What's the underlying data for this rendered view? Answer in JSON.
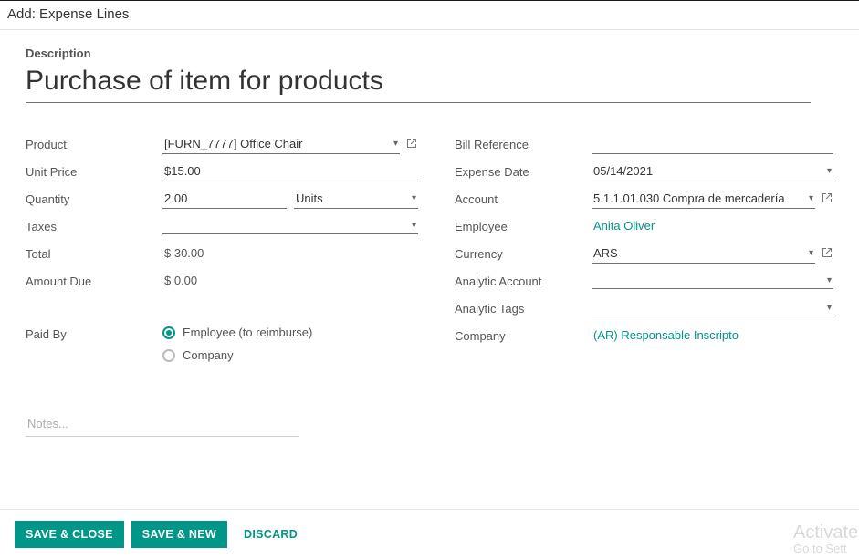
{
  "header": {
    "title": "Add: Expense Lines"
  },
  "description": {
    "label": "Description",
    "value": "Purchase of item for products"
  },
  "left": {
    "product": {
      "label": "Product",
      "value": "[FURN_7777] Office Chair"
    },
    "unit_price": {
      "label": "Unit Price",
      "value": "$15.00"
    },
    "quantity": {
      "label": "Quantity",
      "value": "2.00",
      "uom": "Units"
    },
    "taxes": {
      "label": "Taxes",
      "value": ""
    },
    "total": {
      "label": "Total",
      "value": "$ 30.00"
    },
    "amount_due": {
      "label": "Amount Due",
      "value": "$ 0.00"
    }
  },
  "right": {
    "bill_ref": {
      "label": "Bill Reference",
      "value": ""
    },
    "date": {
      "label": "Expense Date",
      "value": "05/14/2021"
    },
    "account": {
      "label": "Account",
      "value": "5.1.1.01.030 Compra de mercadería"
    },
    "employee": {
      "label": "Employee",
      "value": "Anita Oliver"
    },
    "currency": {
      "label": "Currency",
      "value": "ARS"
    },
    "analytic_acc": {
      "label": "Analytic Account",
      "value": ""
    },
    "analytic_tags": {
      "label": "Analytic Tags",
      "value": ""
    },
    "company": {
      "label": "Company",
      "value": "(AR) Responsable Inscripto"
    }
  },
  "paid_by": {
    "label": "Paid By",
    "options": [
      {
        "label": "Employee (to reimburse)",
        "selected": true
      },
      {
        "label": "Company",
        "selected": false
      }
    ]
  },
  "notes": {
    "placeholder": "Notes...",
    "value": ""
  },
  "footer": {
    "save_close": "SAVE & CLOSE",
    "save_new": "SAVE & NEW",
    "discard": "DISCARD"
  },
  "watermark": {
    "line1": "Activate",
    "line2": "Go to Sett"
  }
}
